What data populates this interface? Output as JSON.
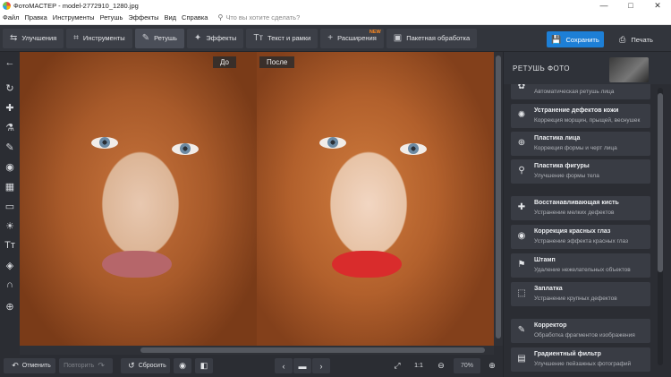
{
  "window": {
    "title": "ФотоМАСТЕР - model-2772910_1280.jpg",
    "controls": [
      "—",
      "□",
      "✕"
    ]
  },
  "menu": {
    "items": [
      "Файл",
      "Правка",
      "Инструменты",
      "Ретушь",
      "Эффекты",
      "Вид",
      "Справка"
    ],
    "search_placeholder": "Что вы хотите сделать?"
  },
  "toolbar": {
    "tabs": [
      {
        "label": "Улучшения",
        "icon": "⇆"
      },
      {
        "label": "Инструменты",
        "icon": "⌗"
      },
      {
        "label": "Ретушь",
        "icon": "✎"
      },
      {
        "label": "Эффекты",
        "icon": "✦"
      },
      {
        "label": "Текст и рамки",
        "icon": "Tт"
      },
      {
        "label": "Расширения",
        "icon": "+",
        "badge": "NEW"
      },
      {
        "label": "Пакетная обработка",
        "icon": "▣"
      }
    ],
    "active_tab": "Ретушь",
    "save_label": "Сохранить",
    "print_label": "Печать"
  },
  "canvas": {
    "label_before": "До",
    "label_after": "После"
  },
  "left_tools": [
    "←",
    "↻",
    "✚",
    "⚗",
    "✎",
    "◉",
    "▦",
    "▭",
    "☀",
    "Tт",
    "◈",
    "∩",
    "⊕"
  ],
  "right_panel": {
    "title": "РЕТУШЬ ФОТО",
    "items": [
      {
        "title": "",
        "desc": "Автоматическая ретушь лица",
        "icon": "✿"
      },
      {
        "title": "Устранение дефектов кожи",
        "desc": "Коррекция морщин, прыщей, веснушек",
        "icon": "✺"
      },
      {
        "title": "Пластика лица",
        "desc": "Коррекция формы и черт лица",
        "icon": "⊕"
      },
      {
        "title": "Пластика фигуры",
        "desc": "Улучшение формы тела",
        "icon": "⚲"
      },
      {
        "title": "Восстанавливающая кисть",
        "desc": "Устранение мелких дефектов",
        "icon": "✚"
      },
      {
        "title": "Коррекция красных глаз",
        "desc": "Устранение эффекта красных глаз",
        "icon": "◉"
      },
      {
        "title": "Штамп",
        "desc": "Удаление нежелательных объектов",
        "icon": "⚑"
      },
      {
        "title": "Заплатка",
        "desc": "Устранение крупных дефектов",
        "icon": "⬚"
      },
      {
        "title": "Корректор",
        "desc": "Обработка фрагментов изображения",
        "icon": "✎"
      },
      {
        "title": "Градиентный фильтр",
        "desc": "Улучшение пейзажных фотографий",
        "icon": "▤"
      }
    ]
  },
  "bottombar": {
    "undo_label": "Отменить",
    "redo_label": "Повторить",
    "reset_label": "Сбросить",
    "ratio_label": "1:1",
    "zoom_value": "70%"
  },
  "colors": {
    "accent": "#1d7fd6",
    "new_badge": "#ff8a1f"
  }
}
